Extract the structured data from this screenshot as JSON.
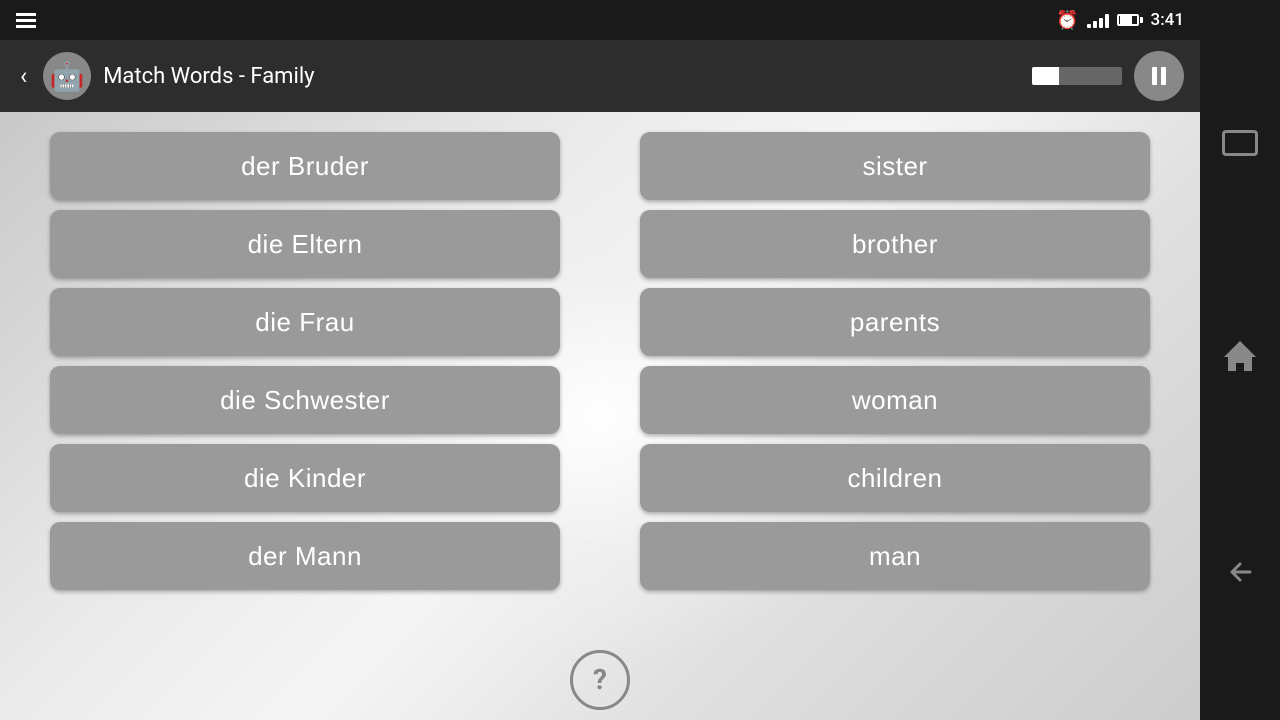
{
  "statusBar": {
    "time": "3:41"
  },
  "titleBar": {
    "title": "Match Words - Family",
    "backLabel": "‹",
    "progressPercent": 30
  },
  "buttons": {
    "pauseLabel": "⏸",
    "helpLabel": "?"
  },
  "germanWords": [
    {
      "id": "g1",
      "text": "der Bruder"
    },
    {
      "id": "g2",
      "text": "die Eltern"
    },
    {
      "id": "g3",
      "text": "die Frau"
    },
    {
      "id": "g4",
      "text": "die Schwester"
    },
    {
      "id": "g5",
      "text": "die Kinder"
    },
    {
      "id": "g6",
      "text": "der Mann"
    }
  ],
  "englishWords": [
    {
      "id": "e1",
      "text": "sister"
    },
    {
      "id": "e2",
      "text": "brother"
    },
    {
      "id": "e3",
      "text": "parents"
    },
    {
      "id": "e4",
      "text": "woman"
    },
    {
      "id": "e5",
      "text": "children"
    },
    {
      "id": "e6",
      "text": "man"
    }
  ]
}
